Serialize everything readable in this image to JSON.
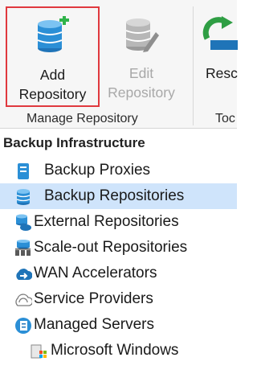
{
  "ribbon": {
    "add_repository": {
      "line1": "Add",
      "line2": "Repository"
    },
    "edit_repository": {
      "line1": "Edit",
      "line2": "Repository"
    },
    "rescan": {
      "line1": "Resc"
    },
    "group_manage": "Manage Repository",
    "group_tools": "Toc",
    "colors": {
      "highlight_border": "#e0393e",
      "db_blue": "#2b8fd6",
      "add_green": "#2fb34a"
    }
  },
  "nav": {
    "section_title": "Backup Infrastructure",
    "items": [
      {
        "label": "Backup Proxies",
        "icon": "backup-proxy-icon"
      },
      {
        "label": "Backup Repositories",
        "icon": "database-icon"
      },
      {
        "label": "External Repositories",
        "icon": "cloud-database-icon"
      },
      {
        "label": "Scale-out Repositories",
        "icon": "scale-out-icon"
      },
      {
        "label": "WAN Accelerators",
        "icon": "wan-accelerator-icon"
      },
      {
        "label": "Service Providers",
        "icon": "service-provider-icon"
      },
      {
        "label": "Managed Servers",
        "icon": "managed-servers-icon"
      },
      {
        "label": "Microsoft Windows",
        "icon": "windows-icon"
      }
    ],
    "selected_color": "#cfe4fb"
  }
}
